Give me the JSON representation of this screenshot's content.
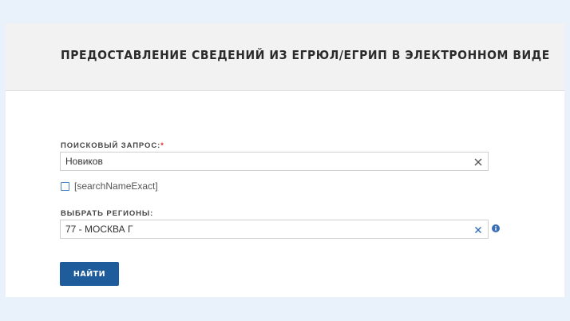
{
  "header": {
    "title": "ПРЕДОСТАВЛЕНИЕ СВЕДЕНИЙ ИЗ ЕГРЮЛ/ЕГРИП В ЭЛЕКТРОННОМ ВИДЕ"
  },
  "search": {
    "label": "ПОИСКОВЫЙ ЗАПРОС:",
    "required_mark": "*",
    "value": "Новиков",
    "clear_icon": "close-icon"
  },
  "exact_match": {
    "label": "[searchNameExact]",
    "checked": false
  },
  "region": {
    "label": "ВЫБРАТЬ РЕГИОНЫ:",
    "selected": "77 - МОСКВА Г",
    "clear_icon": "close-icon",
    "info_icon": "info-icon"
  },
  "submit": {
    "label": "НАЙТИ"
  },
  "colors": {
    "background": "#e9f2fb",
    "header_bg": "#f2f2f2",
    "button": "#1f5c9c",
    "required": "#d9342b",
    "checkbox_border": "#4a86c8",
    "region_clear": "#2f6db5",
    "info": "#3a6fb5"
  }
}
